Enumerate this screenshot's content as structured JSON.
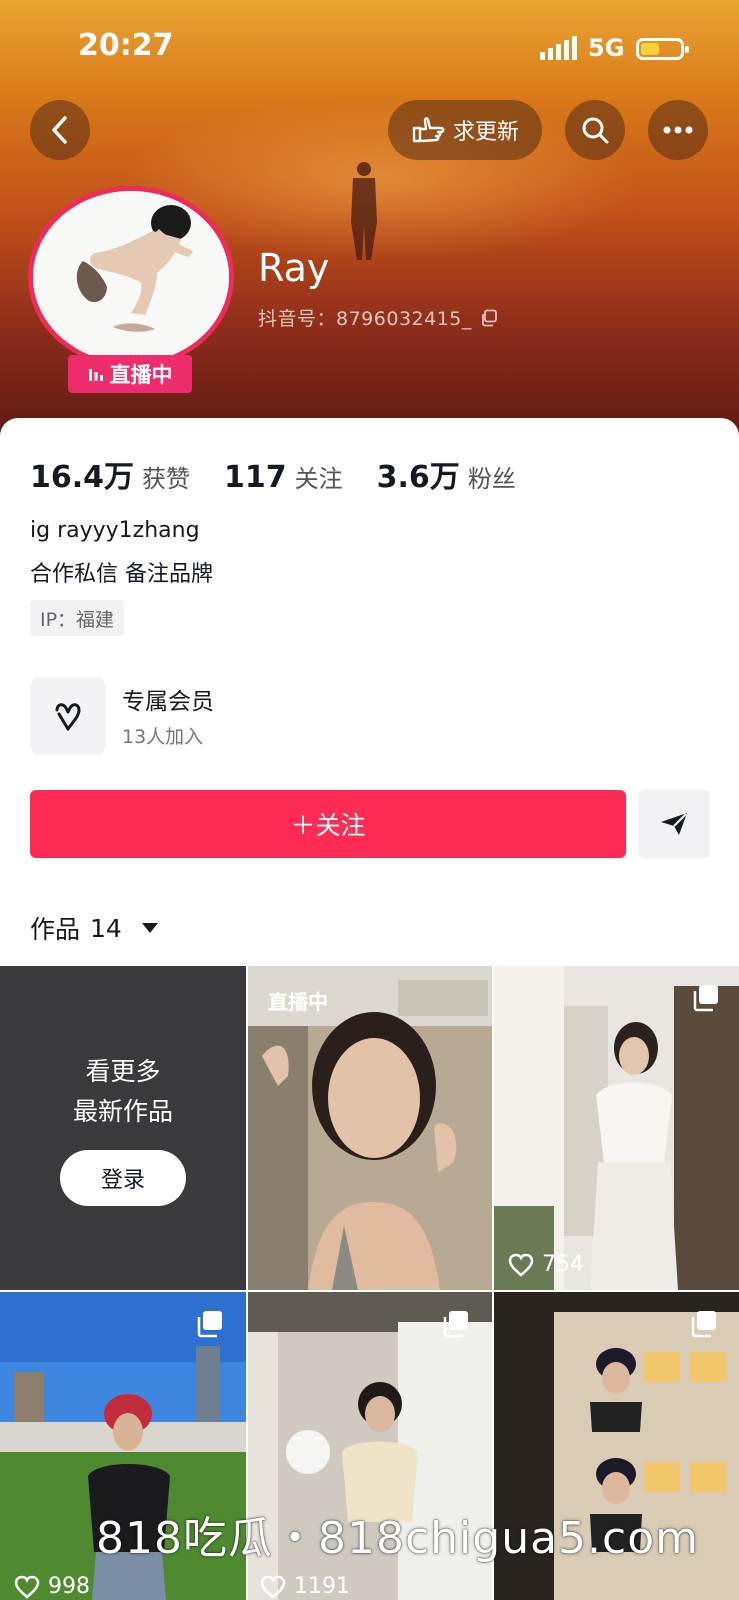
{
  "status_bar": {
    "time": "20:27",
    "network": "5G"
  },
  "header": {
    "request_update_label": "求更新"
  },
  "profile": {
    "name": "Ray",
    "douyin_id": "抖音号：8796032415_",
    "live_badge": "直播中"
  },
  "stats": [
    {
      "value": "16.4万",
      "label": "获赞"
    },
    {
      "value": "117",
      "label": "关注"
    },
    {
      "value": "3.6万",
      "label": "粉丝"
    }
  ],
  "bio": {
    "line1": "ig rayyy1zhang",
    "line2": "合作私信 备注品牌",
    "ip": "IP：福建"
  },
  "membership": {
    "title": "专属会员",
    "subtitle": "13人加入"
  },
  "follow_button": {
    "label": "＋关注"
  },
  "works_tab": {
    "label": "作品",
    "count": "14"
  },
  "grid": {
    "login_tile": {
      "line1": "看更多",
      "line2": "最新作品",
      "button": "登录"
    },
    "live_label": "直播中",
    "likes": [
      "754",
      "998",
      "1191"
    ]
  },
  "watermark": "818吃瓜・818chigua5.com",
  "colors": {
    "accent": "#fe2c55",
    "live_badge": "#ee2c6b"
  }
}
